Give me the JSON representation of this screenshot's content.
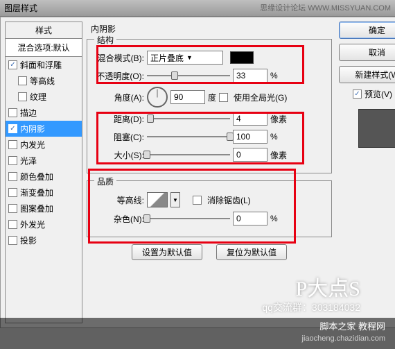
{
  "title": "图层样式",
  "watermark": "思缘设计论坛   WWW.MISSYUAN.COM",
  "styles_panel": {
    "header": "样式",
    "blend_default": "混合选项:默认",
    "items": [
      {
        "label": "斜面和浮雕",
        "checked": true
      },
      {
        "label": "等高线",
        "checked": false,
        "indent": true
      },
      {
        "label": "纹理",
        "checked": false,
        "indent": true
      },
      {
        "label": "描边",
        "checked": false
      },
      {
        "label": "内阴影",
        "checked": true,
        "selected": true
      },
      {
        "label": "内发光",
        "checked": false
      },
      {
        "label": "光泽",
        "checked": false
      },
      {
        "label": "颜色叠加",
        "checked": false
      },
      {
        "label": "渐变叠加",
        "checked": false
      },
      {
        "label": "图案叠加",
        "checked": false
      },
      {
        "label": "外发光",
        "checked": false
      },
      {
        "label": "投影",
        "checked": false
      }
    ]
  },
  "main": {
    "title": "内阴影",
    "structure_legend": "结构",
    "blend_mode_label": "混合模式(B):",
    "blend_mode_value": "正片叠底",
    "opacity_label": "不透明度(O):",
    "opacity_value": "33",
    "angle_label": "角度(A):",
    "angle_value": "90",
    "angle_unit": "度",
    "use_global": "使用全局光(G)",
    "distance_label": "距离(D):",
    "distance_value": "4",
    "px_unit": "像素",
    "choke_label": "阻塞(C):",
    "choke_value": "100",
    "pct_unit": "%",
    "size_label": "大小(S):",
    "size_value": "0",
    "quality_legend": "品质",
    "contour_label": "等高线:",
    "antialias_label": "消除锯齿(L)",
    "noise_label": "杂色(N):",
    "noise_value": "0",
    "make_default": "设置为默认值",
    "reset_default": "复位为默认值"
  },
  "right": {
    "ok": "确定",
    "cancel": "取消",
    "new_style": "新建样式(W",
    "preview": "预览(V)"
  },
  "footer": {
    "logo": "P大点S",
    "qq": "qq交流群：303184032",
    "site1": "脚本之家 教程网",
    "site2": "jiaocheng.chazidian.com"
  }
}
